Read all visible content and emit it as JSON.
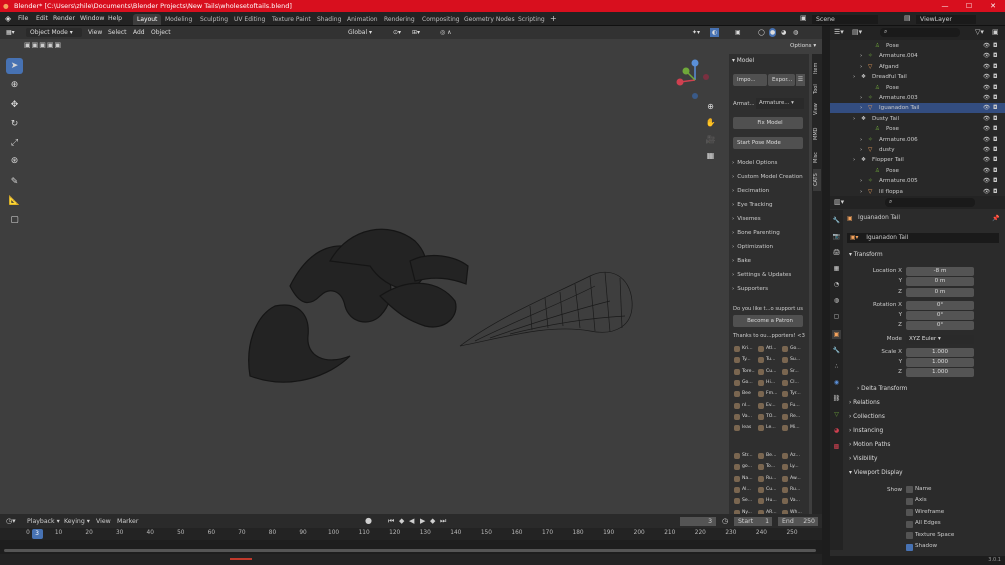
{
  "title": "Blender* [C:\\Users\\zhile\\Documents\\Blender Projects\\New Tails\\wholesetoftails.blend]",
  "menu": [
    "File",
    "Edit",
    "Render",
    "Window",
    "Help"
  ],
  "workspaces": [
    "Layout",
    "Modeling",
    "Sculpting",
    "UV Editing",
    "Texture Paint",
    "Shading",
    "Animation",
    "Rendering",
    "Compositing",
    "Geometry Nodes",
    "Scripting"
  ],
  "scene": "Scene",
  "view_layer": "ViewLayer",
  "viewport_header": {
    "mode": "Object Mode",
    "menus": [
      "View",
      "Select",
      "Add",
      "Object"
    ],
    "orientation": "Global",
    "options": "Options"
  },
  "npanel": {
    "model_header": "Model",
    "import": "Impo...",
    "export": "Expor...",
    "armature_label": "Armat...",
    "armature_value": "Armature...",
    "fix_model": "Fix Model",
    "start_pose": "Start Pose Mode",
    "sections": [
      "Model Options",
      "Custom Model Creation",
      "Decimation",
      "Eye Tracking",
      "Visemes",
      "Bone Parenting",
      "Optimization",
      "Bake",
      "Settings & Updates",
      "Supporters"
    ],
    "support_question": "Do you like t...o support us",
    "patron_button": "Become a Patron",
    "thanks": "Thanks to ou...pporters! <3",
    "supporters": [
      "Kri...",
      "Atl...",
      "Go...",
      "Ty...",
      "Tu...",
      "Su...",
      "Tore...",
      "Cu...",
      "Sr...",
      "Go...",
      "Hi...",
      "Cl...",
      "Bee",
      "Fm...",
      "Tyr...",
      "nl...",
      "Ev...",
      "Fu...",
      "Va...",
      "TO...",
      "Re...",
      "leas",
      "Le...",
      "Mi..."
    ],
    "supporters2": [
      "Str...",
      "Be...",
      "Az...",
      "go...",
      "To...",
      "Ly...",
      "Na...",
      "Ru...",
      "Aw...",
      "Al...",
      "Cu...",
      "Ru...",
      "Se...",
      "Hu...",
      "Va...",
      "Ny...",
      "AR...",
      "Wh..."
    ],
    "tabs": [
      "Item",
      "Tool",
      "View",
      "MMD",
      "Misc",
      "CATS"
    ]
  },
  "outliner": {
    "rows": [
      {
        "indent": 3,
        "icon": "bone-icon",
        "name": "Pose",
        "sel": false
      },
      {
        "indent": 2,
        "icon": "armature-icon",
        "name": "Armature.004",
        "sel": false
      },
      {
        "indent": 2,
        "icon": "mesh-icon",
        "name": "Afgand",
        "sel": false
      },
      {
        "indent": 1,
        "icon": "collection-icon",
        "name": "Dreadful Tail",
        "sel": false
      },
      {
        "indent": 3,
        "icon": "bone-icon",
        "name": "Pose",
        "sel": false
      },
      {
        "indent": 2,
        "icon": "armature-icon",
        "name": "Armature.003",
        "sel": false
      },
      {
        "indent": 2,
        "icon": "mesh-icon",
        "name": "Iguanadon Tail",
        "sel": true
      },
      {
        "indent": 1,
        "icon": "collection-icon",
        "name": "Dusty Tail",
        "sel": false
      },
      {
        "indent": 3,
        "icon": "bone-icon",
        "name": "Pose",
        "sel": false
      },
      {
        "indent": 2,
        "icon": "armature-icon",
        "name": "Armature.006",
        "sel": false
      },
      {
        "indent": 2,
        "icon": "mesh-icon",
        "name": "dusty",
        "sel": false
      },
      {
        "indent": 1,
        "icon": "collection-icon",
        "name": "Flopper Tail",
        "sel": false
      },
      {
        "indent": 3,
        "icon": "bone-icon",
        "name": "Pose",
        "sel": false
      },
      {
        "indent": 2,
        "icon": "armature-icon",
        "name": "Armature.005",
        "sel": false
      },
      {
        "indent": 2,
        "icon": "mesh-icon",
        "name": "lil floppa",
        "sel": false
      }
    ]
  },
  "properties": {
    "object_name": "Iguanadon Tail",
    "datablock_name": "Iguanadon Tail",
    "transform_header": "Transform",
    "location": {
      "label": "Location X",
      "x": "-8 m",
      "y": "0 m",
      "z": "0 m"
    },
    "rotation": {
      "label": "Rotation X",
      "x": "0°",
      "y": "0°",
      "z": "0°"
    },
    "mode_label": "Mode",
    "mode_value": "XYZ Euler",
    "scale": {
      "label": "Scale X",
      "x": "1.000",
      "y": "1.000",
      "z": "1.000"
    },
    "axis_y": "Y",
    "axis_z": "Z",
    "sections": [
      "Delta Transform",
      "Relations",
      "Collections",
      "Instancing",
      "Motion Paths",
      "Visibility"
    ],
    "viewport_display": "Viewport Display",
    "show_label": "Show",
    "show_items": [
      {
        "label": "Name",
        "on": false
      },
      {
        "label": "Axis",
        "on": false
      },
      {
        "label": "Wireframe",
        "on": false
      },
      {
        "label": "All Edges",
        "on": false
      },
      {
        "label": "Texture Space",
        "on": false
      },
      {
        "label": "Shadow",
        "on": true
      }
    ]
  },
  "timeline": {
    "menus": [
      "Playback",
      "Keying",
      "View",
      "Marker"
    ],
    "current_frame": "3",
    "start_label": "Start",
    "start": "1",
    "end_label": "End",
    "end": "250",
    "ticks": [
      "0",
      "10",
      "20",
      "30",
      "40",
      "50",
      "60",
      "70",
      "80",
      "90",
      "100",
      "110",
      "120",
      "130",
      "140",
      "150",
      "160",
      "170",
      "180",
      "190",
      "200",
      "210",
      "220",
      "230",
      "240",
      "250"
    ],
    "playhead": "3"
  },
  "version": "3.0.1",
  "colors": {
    "accent": "#4772b3",
    "titlebar": "#d80f1e",
    "outliner_sel": "#334d80"
  }
}
